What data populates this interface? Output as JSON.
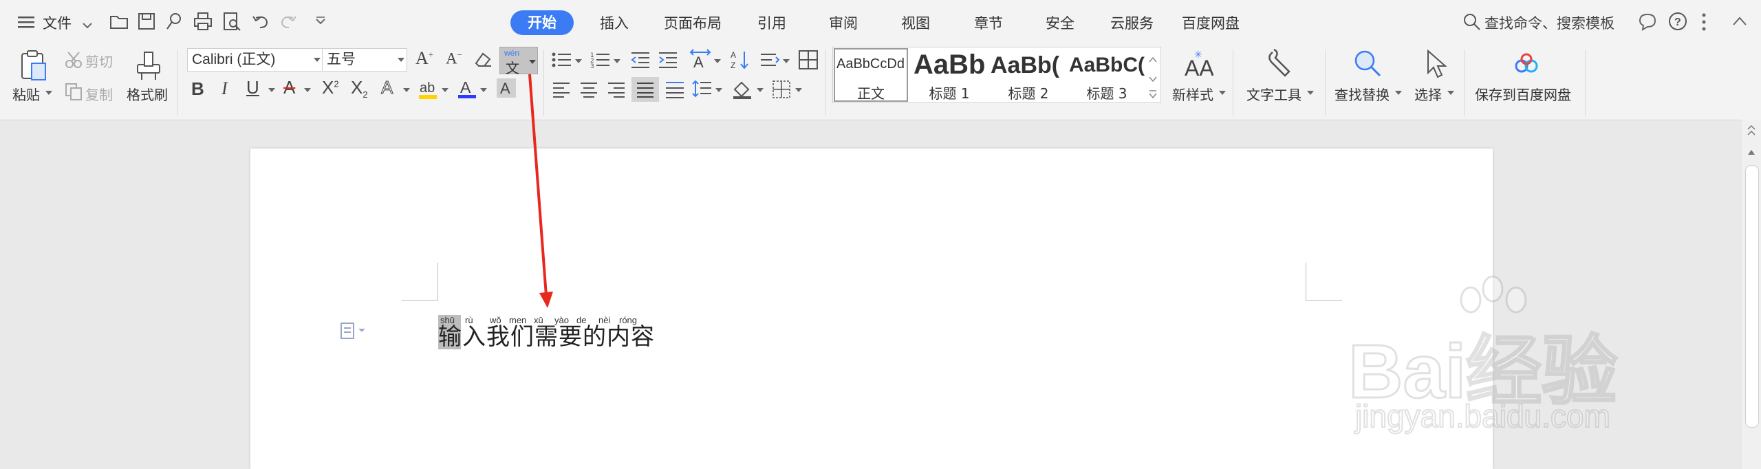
{
  "menu": {
    "file_label": "文件",
    "tabs": [
      {
        "label": "开始",
        "active": true
      },
      {
        "label": "插入"
      },
      {
        "label": "页面布局"
      },
      {
        "label": "引用"
      },
      {
        "label": "审阅"
      },
      {
        "label": "视图"
      },
      {
        "label": "章节"
      },
      {
        "label": "安全"
      },
      {
        "label": "云服务"
      },
      {
        "label": "百度网盘"
      }
    ],
    "search_placeholder": "查找命令、搜索模板"
  },
  "ribbon": {
    "paste_label": "粘贴",
    "cut_label": "剪切",
    "copy_label": "复制",
    "format_painter_label": "格式刷",
    "font_name": "Calibri (正文)",
    "font_size": "五号",
    "pinyin_button_text_top": "wén",
    "pinyin_button_text_bottom": "文",
    "styles": [
      {
        "preview": "AaBbCcDd",
        "name": "正文"
      },
      {
        "preview": "AaBb",
        "name": "标题 1"
      },
      {
        "preview": "AaBb(",
        "name": "标题 2"
      },
      {
        "preview": "AaBbC(",
        "name": "标题 3"
      }
    ],
    "new_style_label": "新样式",
    "text_tools_label": "文字工具",
    "find_replace_label": "查找替换",
    "select_label": "选择",
    "save_baidu_label": "保存到百度网盘"
  },
  "document": {
    "text": "输入我们需要的内容",
    "pinyin": [
      "shū",
      "rù",
      "wǒ",
      "men",
      "xū",
      "yào",
      "de",
      "nèi",
      "róng"
    ]
  },
  "watermark": {
    "text": "Bai经验",
    "url": "jingyan.baidu.com"
  },
  "colors": {
    "accent": "#3b7cf4",
    "arrow": "#e8271f",
    "highlight": "#ffd400",
    "font_color": "#2b3cff"
  }
}
